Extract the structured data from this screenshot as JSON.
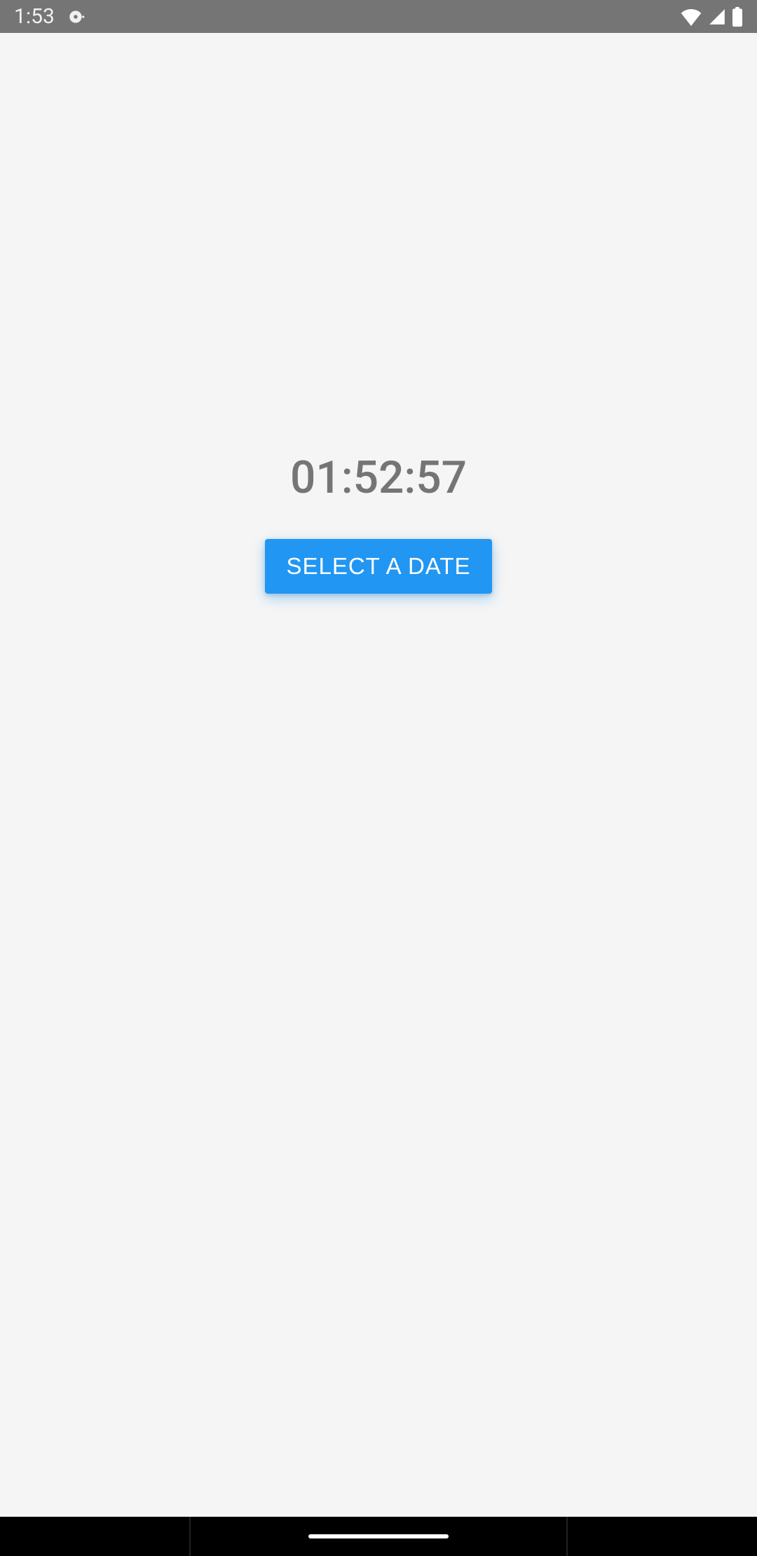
{
  "status_bar": {
    "time": "1:53"
  },
  "main": {
    "time_display": "01:52:57",
    "button_label": "SELECT A DATE"
  },
  "colors": {
    "status_bg": "#757575",
    "content_bg": "#f5f5f5",
    "time_text": "#757575",
    "button_bg": "#2196F3",
    "button_text": "#ffffff"
  }
}
